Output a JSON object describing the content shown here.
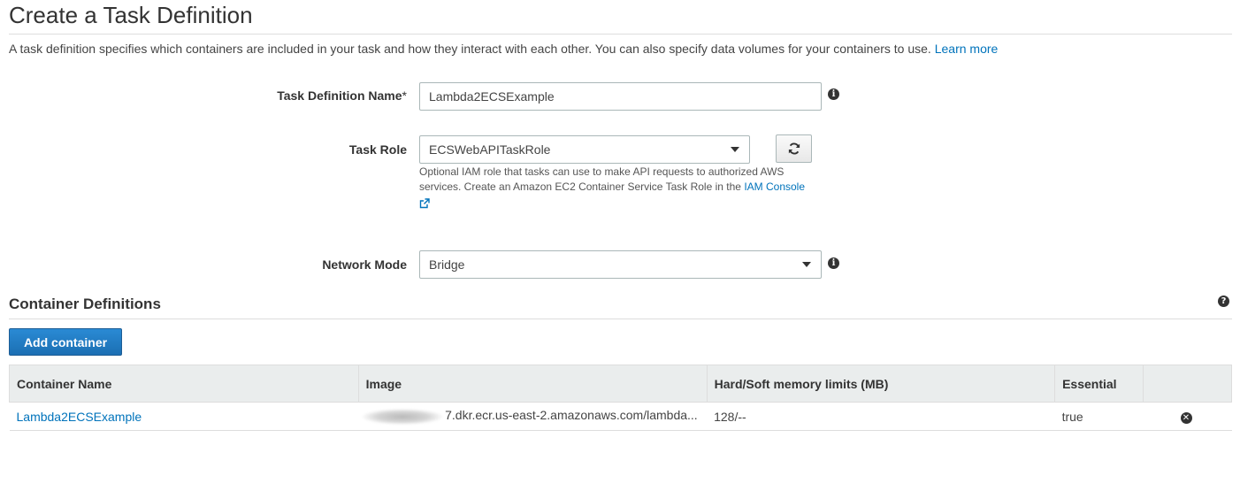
{
  "page": {
    "title": "Create a Task Definition",
    "intro": "A task definition specifies which containers are included in your task and how they interact with each other. You can also specify data volumes for your containers to use.",
    "learn_more": "Learn more"
  },
  "form": {
    "task_def_name": {
      "label": "Task Definition Name",
      "required_mark": "*",
      "value": "Lambda2ECSExample"
    },
    "task_role": {
      "label": "Task Role",
      "selected": "ECSWebAPITaskRole",
      "help_text": "Optional IAM role that tasks can use to make API requests to authorized AWS services. Create an Amazon EC2 Container Service Task Role in the",
      "help_link": "IAM Console"
    },
    "network_mode": {
      "label": "Network Mode",
      "selected": "Bridge"
    }
  },
  "containers": {
    "section_title": "Container Definitions",
    "add_button": "Add container",
    "columns": [
      "Container Name",
      "Image",
      "Hard/Soft memory limits (MB)",
      "Essential"
    ],
    "rows": [
      {
        "name": "Lambda2ECSExample",
        "image_suffix": "7.dkr.ecr.us-east-2.amazonaws.com/lambda...",
        "memory": "128/--",
        "essential": "true"
      }
    ]
  },
  "icons": {
    "info": "info-icon",
    "help": "help-icon",
    "refresh": "refresh-icon",
    "external_link": "external-link-icon",
    "remove": "remove-icon",
    "dropdown": "caret-down-icon"
  },
  "colors": {
    "link": "#0073bb",
    "primary_button": "#1b6fb3",
    "table_header_bg": "#eaeded"
  }
}
